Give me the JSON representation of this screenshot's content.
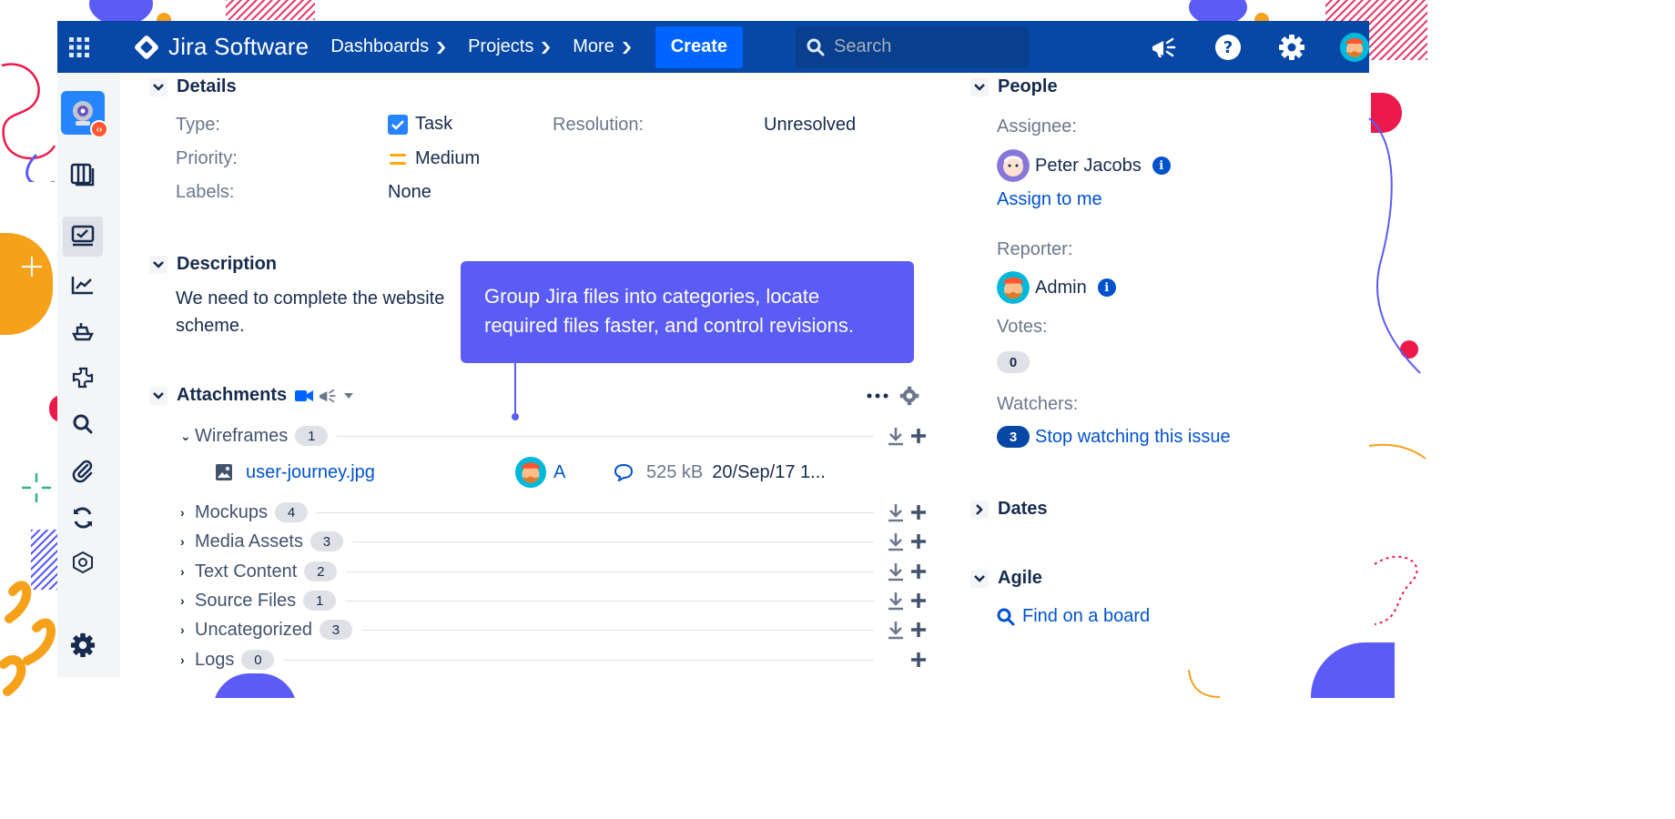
{
  "topnav": {
    "brand": "Jira Software",
    "items": [
      {
        "label": "Dashboards"
      },
      {
        "label": "Projects"
      },
      {
        "label": "More"
      }
    ],
    "create_label": "Create",
    "search_placeholder": "Search"
  },
  "details": {
    "title": "Details",
    "type_label": "Type:",
    "type_value": "Task",
    "priority_label": "Priority:",
    "priority_value": "Medium",
    "labels_label": "Labels:",
    "labels_value": "None",
    "resolution_label": "Resolution:",
    "resolution_value": "Unresolved"
  },
  "description": {
    "title": "Description",
    "text": "We need to complete the website scheme."
  },
  "tooltip": {
    "text": "Group Jira files into categories, locate required files faster, and control revisions."
  },
  "attachments": {
    "title": "Attachments",
    "folders": [
      {
        "name": "Wireframes",
        "count": "1",
        "expanded": true
      },
      {
        "name": "Mockups",
        "count": "4"
      },
      {
        "name": "Media Assets",
        "count": "3"
      },
      {
        "name": "Text Content",
        "count": "2"
      },
      {
        "name": "Source Files",
        "count": "1"
      },
      {
        "name": "Uncategorized",
        "count": "3"
      },
      {
        "name": "Logs",
        "count": "0"
      }
    ],
    "file": {
      "name": "user-journey.jpg",
      "user": "A",
      "size": "525 kB",
      "date": "20/Sep/17 1..."
    }
  },
  "people": {
    "title": "People",
    "assignee_label": "Assignee:",
    "assignee_name": "Peter Jacobs",
    "assign_to_me": "Assign to me",
    "reporter_label": "Reporter:",
    "reporter_name": "Admin",
    "votes_label": "Votes:",
    "votes_count": "0",
    "watchers_label": "Watchers:",
    "watchers_count": "3",
    "watch_link": "Stop watching this issue"
  },
  "dates": {
    "title": "Dates"
  },
  "agile": {
    "title": "Agile",
    "find_link": "Find on a board"
  },
  "colors": {
    "nav": "#0747a6",
    "accent": "#0065ff",
    "tooltip": "#5b5bf5",
    "link": "#0052cc"
  }
}
